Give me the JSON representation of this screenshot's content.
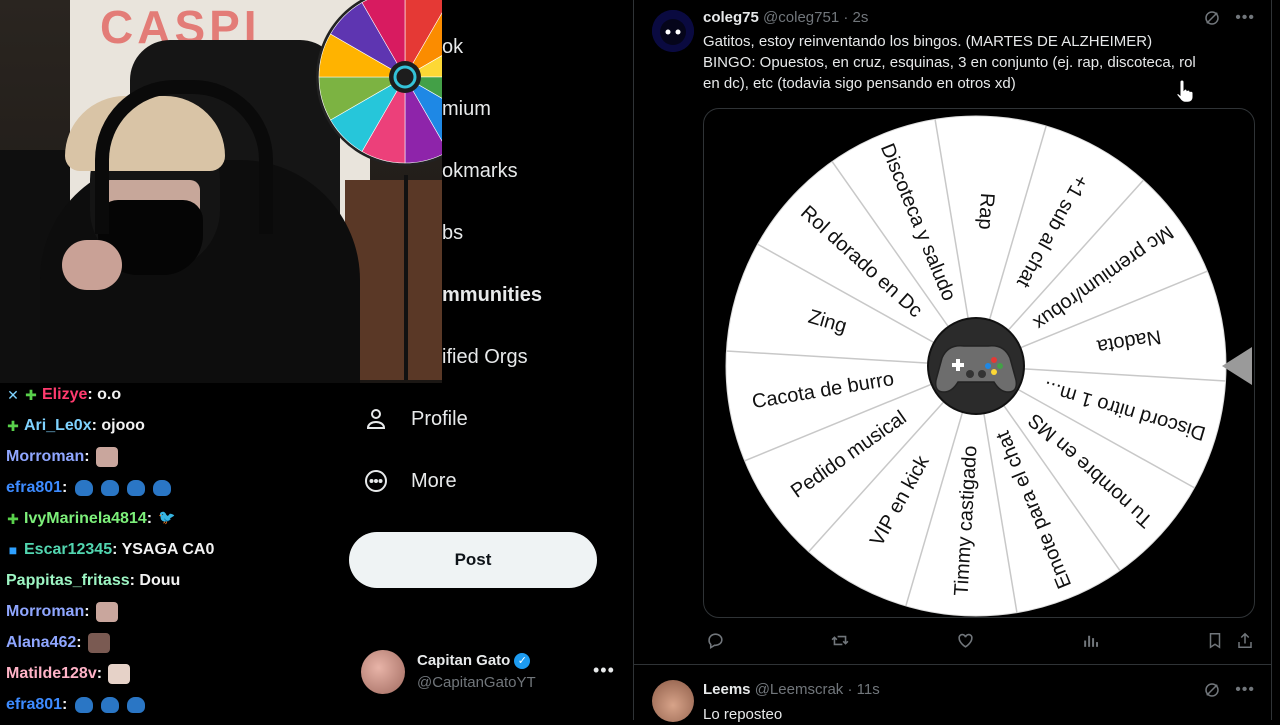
{
  "webcam": {
    "curtain_text": "CASPI"
  },
  "small_wheel_colors": [
    "#e53935",
    "#fb8c00",
    "#fdd835",
    "#43a047",
    "#1e88e5",
    "#8e24aa",
    "#ec407a",
    "#26c6da",
    "#7cb342",
    "#ffb300",
    "#5e35b1",
    "#d81b60"
  ],
  "chat": {
    "lines": [
      {
        "badges": [
          "sword",
          "gem"
        ],
        "name": "Elizye",
        "color": "#ff3b6e",
        "msg": ": o.o",
        "emotes": []
      },
      {
        "badges": [
          "gem"
        ],
        "name": "Ari_Le0x",
        "color": "#7fd3ff",
        "msg": ": ojooo",
        "emotes": []
      },
      {
        "badges": [],
        "name": "Morroman",
        "color": "#8fa6ff",
        "msg": " :",
        "emotes": [
          "img"
        ]
      },
      {
        "badges": [],
        "name": "efra801",
        "color": "#3d8bff",
        "msg": " :",
        "emotes": [
          "cat",
          "cat",
          "cat",
          "cat"
        ]
      },
      {
        "badges": [
          "gem"
        ],
        "name": "IvyMarinela4814",
        "color": "#7df07a",
        "msg": " :",
        "emotes": [
          "bird"
        ]
      },
      {
        "badges": [
          "cube"
        ],
        "name": "Escar12345",
        "color": "#52d6b0",
        "msg": ": YSAGA CA0",
        "emotes": []
      },
      {
        "badges": [],
        "name": "Pappitas_fritass",
        "color": "#9df5c3",
        "msg": ": Douu",
        "emotes": []
      },
      {
        "badges": [],
        "name": "Morroman",
        "color": "#8fa6ff",
        "msg": " :",
        "emotes": [
          "img"
        ]
      },
      {
        "badges": [],
        "name": "Alana462",
        "color": "#8fa6ff",
        "msg": " :",
        "emotes": [
          "img-dark"
        ]
      },
      {
        "badges": [],
        "name": "Matilde128v",
        "color": "#ffb3c7",
        "msg": " :",
        "emotes": [
          "img-light"
        ]
      },
      {
        "badges": [],
        "name": "efra801",
        "color": "#3d8bff",
        "msg": " :",
        "emotes": [
          "cat",
          "cat",
          "cat"
        ]
      }
    ]
  },
  "nav": {
    "partial_items": [
      {
        "label": "ok",
        "bold": false
      },
      {
        "label": "mium",
        "bold": false
      },
      {
        "label": "okmarks",
        "bold": false
      },
      {
        "label": "bs",
        "bold": false
      },
      {
        "label": "mmunities",
        "bold": true
      },
      {
        "label": "ified Orgs",
        "bold": false
      }
    ],
    "profile_label": "Profile",
    "more_label": "More",
    "post_label": "Post",
    "account_name": "Capitan Gato",
    "account_handle": "@CapitanGatoYT"
  },
  "tweet1": {
    "display_name": "coleg75",
    "meta": "@coleg751 · 2s",
    "text_line1": "Gatitos, estoy reinventando los bingos. (MARTES DE ALZHEIMER)",
    "text_line2": "BINGO: Opuestos, en cruz, esquinas, 3 en conjunto (ej. rap, discoteca, rol",
    "text_line3": "en dc), etc (todavia sigo pensando en otros xd)"
  },
  "wheel": {
    "segments": [
      "Rap",
      "+1 sub al chat",
      "Mc premium/robux",
      "Nadota",
      "Discord nitro 1 m...",
      "Tu nombre en MS",
      "Emote para el chat",
      "Timmy castigado",
      "VIP en kick",
      "Pedido musical",
      "Cacota de burro",
      "Zing",
      "Rol dorado en Dc",
      "Discoteca y saludo"
    ]
  },
  "tweet2": {
    "display_name": "Leems",
    "meta": "@Leemscrak · 11s",
    "text": "Lo reposteo"
  }
}
